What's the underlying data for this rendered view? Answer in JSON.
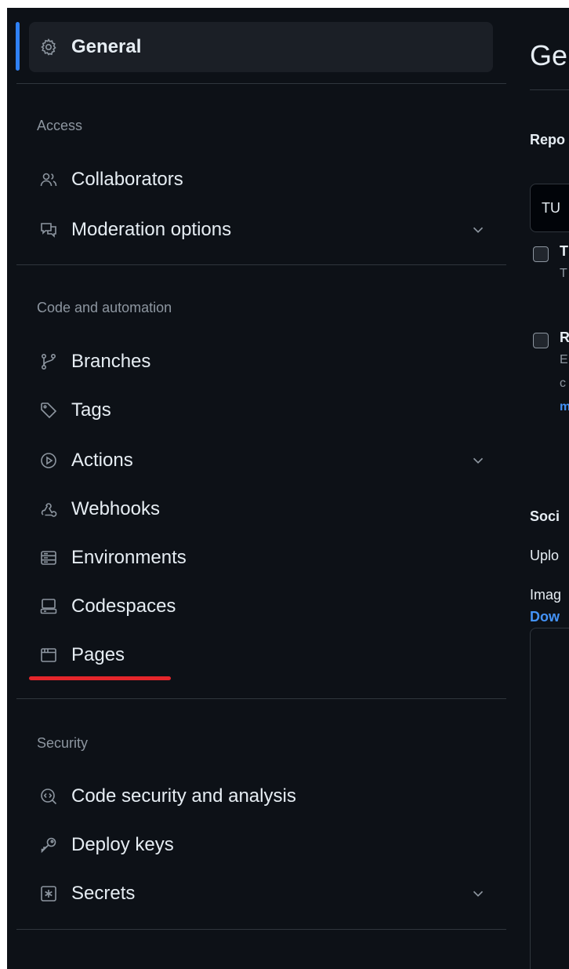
{
  "sidebar": {
    "general": "General",
    "sections": [
      {
        "heading": "Access",
        "items": [
          {
            "label": "Collaborators",
            "icon": "people-icon"
          },
          {
            "label": "Moderation options",
            "icon": "comment-discussion-icon",
            "expandable": true
          }
        ]
      },
      {
        "heading": "Code and automation",
        "items": [
          {
            "label": "Branches",
            "icon": "git-branch-icon"
          },
          {
            "label": "Tags",
            "icon": "tag-icon"
          },
          {
            "label": "Actions",
            "icon": "play-icon",
            "expandable": true
          },
          {
            "label": "Webhooks",
            "icon": "webhook-icon"
          },
          {
            "label": "Environments",
            "icon": "server-icon"
          },
          {
            "label": "Codespaces",
            "icon": "codespaces-icon"
          },
          {
            "label": "Pages",
            "icon": "browser-icon"
          }
        ]
      },
      {
        "heading": "Security",
        "items": [
          {
            "label": "Code security and analysis",
            "icon": "codescan-icon"
          },
          {
            "label": "Deploy keys",
            "icon": "key-icon"
          },
          {
            "label": "Secrets",
            "icon": "key-asterisk-icon",
            "expandable": true
          }
        ]
      }
    ]
  },
  "main": {
    "title": "Ge",
    "repo_label": "Repo",
    "repo_value": "TU",
    "checkbox1_title": "T",
    "checkbox1_desc": "T",
    "checkbox2_title": "R",
    "checkbox2_desc_lines": [
      "E",
      "c",
      "m"
    ],
    "social_label": "Soci",
    "upload_text": "Uplo",
    "image_text": "Imag",
    "download_link": "Dow"
  },
  "colors": {
    "background": "#0d1117",
    "accent": "#2f81f7",
    "underline_annotation": "#e5262b",
    "link": "#4493f8"
  }
}
